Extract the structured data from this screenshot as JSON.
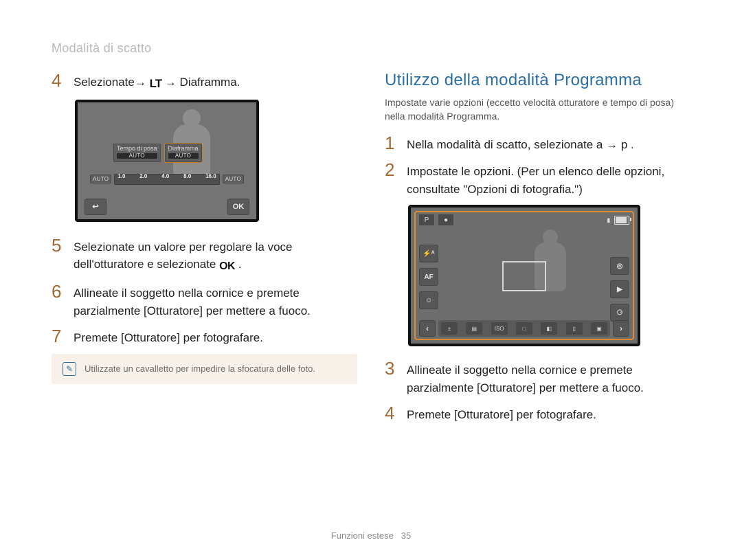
{
  "header": {
    "breadcrumb": "Modalità di scatto"
  },
  "left": {
    "step4_pre": "Selezionate→ ",
    "step4_icon_name": "LT",
    "step4_post": " → Diaframma.",
    "camA": {
      "opt1_label": "Tempo di posa",
      "opt1_sub": "AUTO",
      "opt2_label": "Diaframma",
      "opt2_sub": "AUTO",
      "left_chip": "AUTO",
      "right_chip": "AUTO",
      "ticks": [
        "1.0",
        "2.0",
        "4.0",
        "8.0",
        "16.0"
      ],
      "back": "↩",
      "ok": "OK"
    },
    "step5_pre": "Selezionate un valore per regolare la voce dell'otturatore e selezionate ",
    "step5_icon": "OK",
    "step5_post": ".",
    "step6": "Allineate il soggetto nella cornice e premete parzialmente [Otturatore] per mettere a fuoco.",
    "step7": "Premete [Otturatore] per fotografare.",
    "tip": "Utilizzate un cavalletto per impedire la sfocatura delle foto."
  },
  "right": {
    "title": "Utilizzo della modalità Programma",
    "desc": "Impostate varie opzioni (eccetto velocità otturatore e tempo di posa) nella modalità Programma.",
    "step1": "Nella modalità di scatto, selezionate a  → p  .",
    "step2": "Impostate le opzioni. (Per un elenco delle opzioni, consultate \"Opzioni di fotografia.\")",
    "camB": {
      "mode_icon": "P",
      "rec_icon": "●",
      "status_bar": "▮",
      "batt_pct": 90,
      "left_icons": [
        "⚡ᴬ",
        "AF",
        "☺"
      ],
      "right_icons": [
        "◎",
        "▶",
        "⚆"
      ],
      "nav_left": "‹",
      "nav_right": "›",
      "strip": [
        "±",
        "▤",
        "ISO",
        "□",
        "◧",
        "▯",
        "▣"
      ]
    },
    "step3": "Allineate il soggetto nella cornice e premete parzialmente [Otturatore] per mettere a fuoco.",
    "step4": "Premete [Otturatore] per fotografare."
  },
  "footer": {
    "section": "Funzioni estese",
    "page": "35"
  },
  "nums": {
    "n1": "1",
    "n2": "2",
    "n3": "3",
    "n4": "4",
    "n5": "5",
    "n6": "6",
    "n7": "7"
  }
}
